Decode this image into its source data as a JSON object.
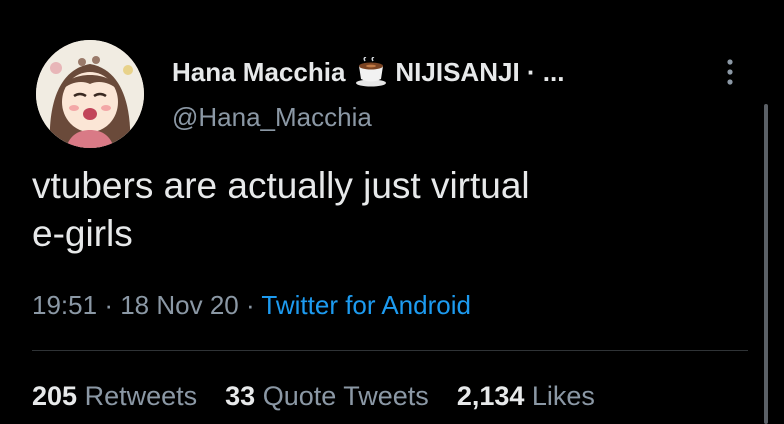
{
  "tweet": {
    "author": {
      "display_name": "Hana Macchia",
      "emoji_icon": "coffee-cup-emoji",
      "name_suffix": "NIJISANJI · ...",
      "handle": "@Hana_Macchia"
    },
    "text_line1": "vtubers are actually just virtual",
    "text_line2": "e-girls",
    "time": "19:51",
    "date": "18 Nov 20",
    "separator": "·",
    "source": "Twitter for Android",
    "stats": {
      "retweets_count": "205",
      "retweets_label": "Retweets",
      "quotes_count": "33",
      "quotes_label": "Quote Tweets",
      "likes_count": "2,134",
      "likes_label": "Likes"
    }
  },
  "colors": {
    "background": "#000000",
    "text": "#e7e9ea",
    "muted": "#8b98a5",
    "link": "#1d9bf0"
  }
}
